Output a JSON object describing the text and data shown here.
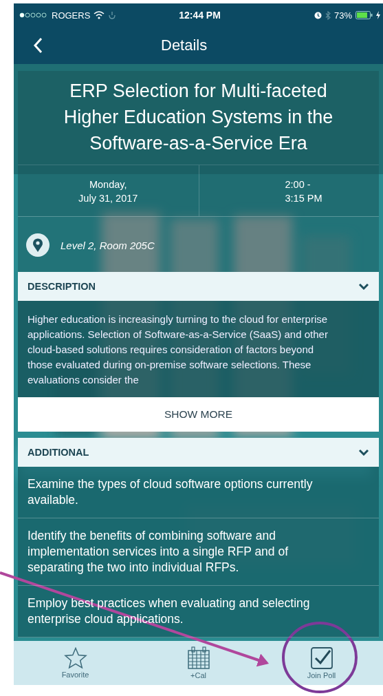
{
  "status_bar": {
    "carrier": "ROGERS",
    "time": "12:44 PM",
    "battery": "73%"
  },
  "nav_bar": {
    "title": "Details"
  },
  "session": {
    "title": "ERP Selection for Multi-faceted Higher Education Systems in the Software-as-a-Service Era",
    "date": "Monday,\nJuly 31, 2017",
    "time": "2:00 -\n3:15 PM",
    "location": "Level 2, Room 205C"
  },
  "sections": [
    {
      "kind": "text",
      "title": "DESCRIPTION",
      "expanded": true,
      "body": "Higher education is increasingly turning to the cloud for enterprise applications. Selection of Software-as-a-Service (SaaS) and other cloud-based solutions requires consideration of factors beyond those evaluated during on-premise software selections. These evaluations consider the",
      "more_button": "SHOW MORE"
    },
    {
      "kind": "list",
      "title": "ADDITIONAL",
      "expanded": true,
      "items": [
        "Examine the types of cloud software options currently available.",
        "Identify the benefits of combining software and implementation services into a single RFP and of separating the two into individual RFPs.",
        "Employ best practices when evaluating and selecting enterprise cloud applications."
      ]
    }
  ],
  "tab_bar": [
    {
      "kind": "favorite",
      "label": "Favorite"
    },
    {
      "kind": "calendar",
      "label": "+Cal"
    },
    {
      "kind": "poll",
      "label": "Join Poll"
    }
  ]
}
